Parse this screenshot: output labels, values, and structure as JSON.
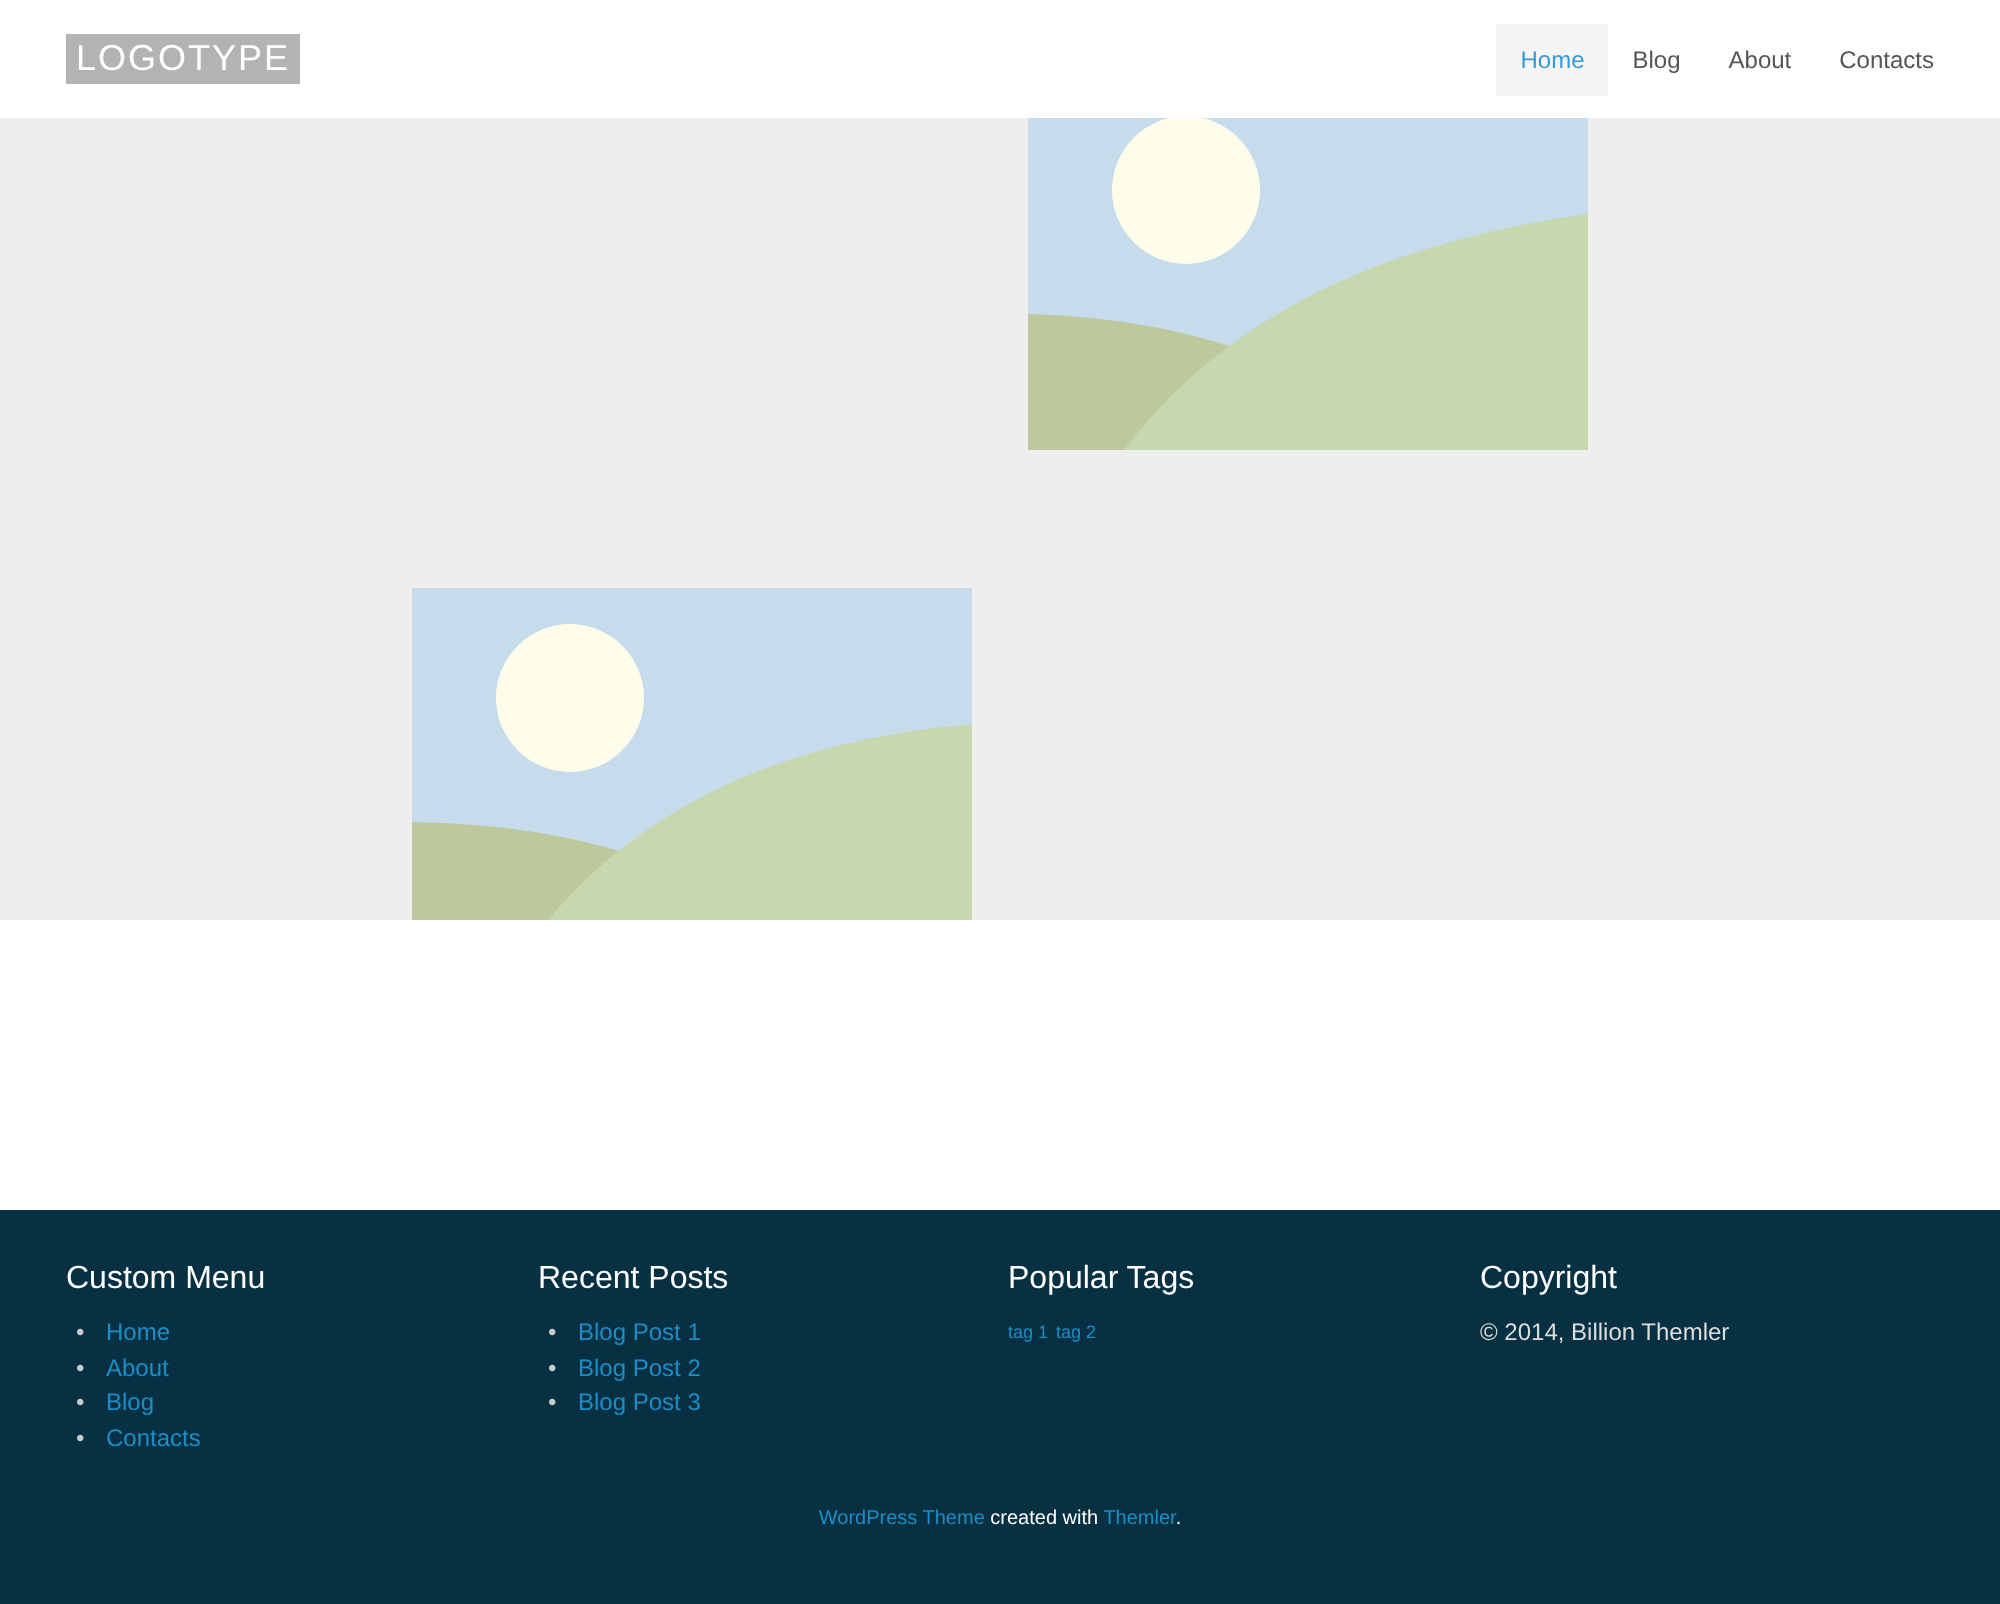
{
  "header": {
    "logo": "LOGOTYPE",
    "nav": [
      {
        "label": "Home",
        "selected": true
      },
      {
        "label": "Blog",
        "selected": false
      },
      {
        "label": "About",
        "selected": false
      },
      {
        "label": "Contacts",
        "selected": false
      }
    ]
  },
  "footer": {
    "columns": [
      {
        "kind": "links",
        "title": "Custom Menu",
        "bullet": "•",
        "items": [
          "Home",
          "About",
          "Blog",
          "Contacts"
        ]
      },
      {
        "kind": "links",
        "title": "Recent Posts",
        "bullet": "•",
        "items": [
          "Blog Post 1",
          "Blog Post 2",
          "Blog Post 3"
        ]
      },
      {
        "kind": "tags",
        "title": "Popular Tags",
        "items": [
          "tag 1",
          "tag 2"
        ]
      },
      {
        "kind": "text",
        "title": "Copyright",
        "text": "© 2014, Billion Themler"
      }
    ],
    "credit": [
      {
        "kind": "link",
        "text": "WordPress Theme"
      },
      {
        "kind": "text",
        "text": " created with "
      },
      {
        "kind": "link",
        "text": "Themler"
      },
      {
        "kind": "text",
        "text": "."
      }
    ]
  }
}
